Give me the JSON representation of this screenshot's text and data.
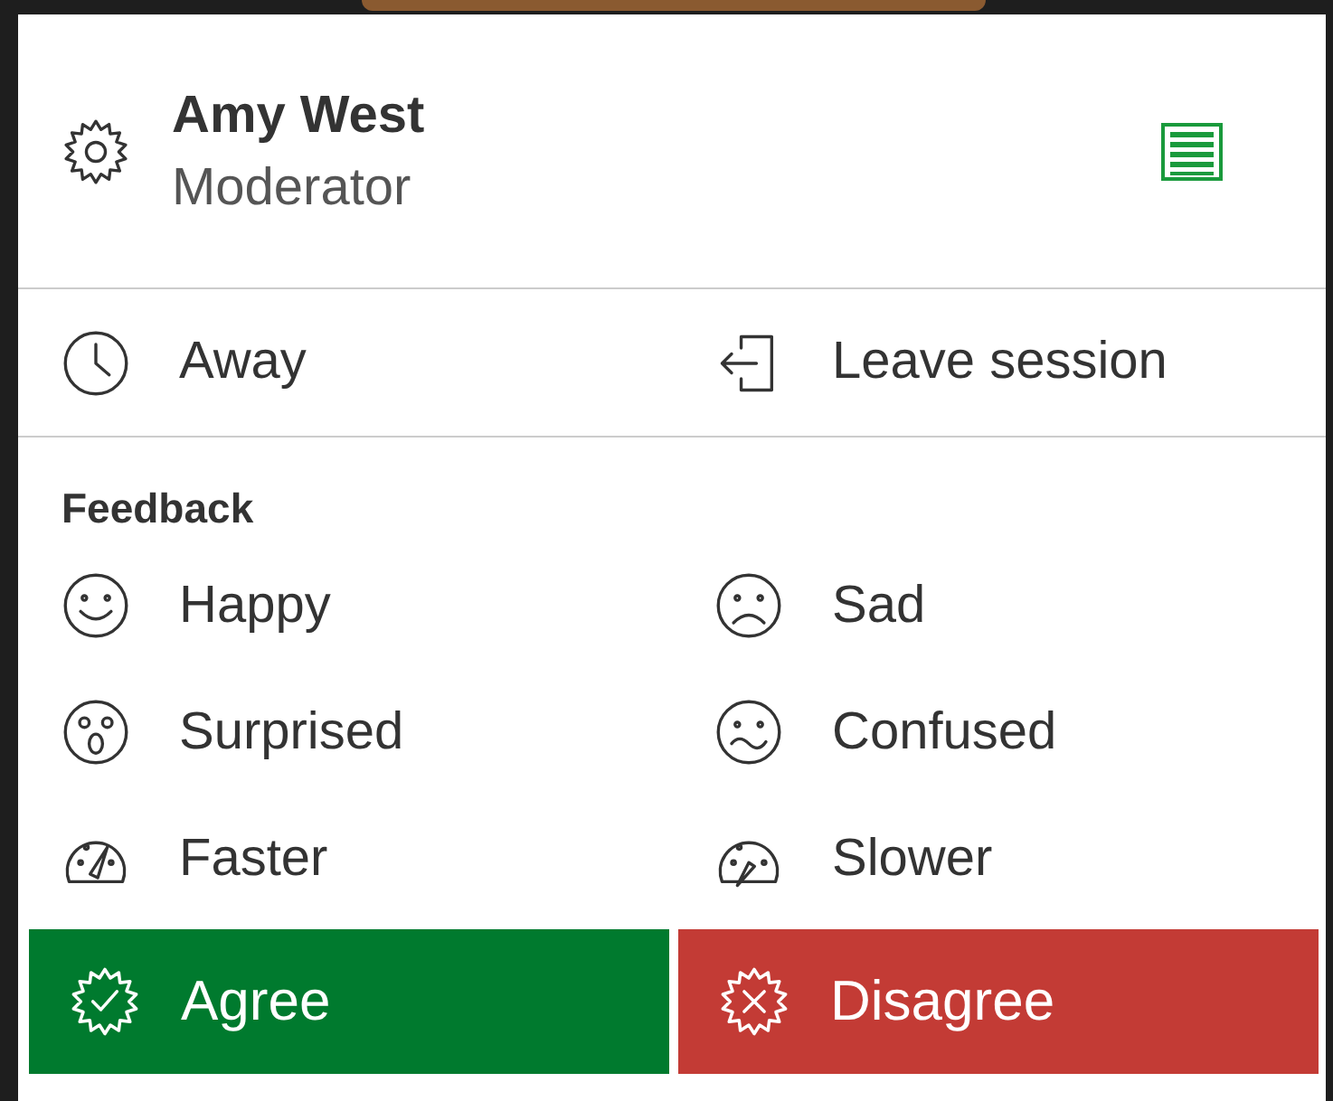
{
  "user": {
    "name": "Amy West",
    "role": "Moderator"
  },
  "actions": [
    {
      "kind": "away",
      "label": "Away"
    },
    {
      "kind": "leave",
      "label": "Leave session"
    }
  ],
  "feedback": {
    "title": "Feedback",
    "items": [
      {
        "kind": "happy",
        "label": "Happy"
      },
      {
        "kind": "sad",
        "label": "Sad"
      },
      {
        "kind": "surprised",
        "label": "Surprised"
      },
      {
        "kind": "confused",
        "label": "Confused"
      },
      {
        "kind": "faster",
        "label": "Faster"
      },
      {
        "kind": "slower",
        "label": "Slower"
      }
    ]
  },
  "buttons": [
    {
      "kind": "agree",
      "label": "Agree",
      "color": "#007a2e"
    },
    {
      "kind": "disagree",
      "label": "Disagree",
      "color": "#c33b35"
    }
  ]
}
